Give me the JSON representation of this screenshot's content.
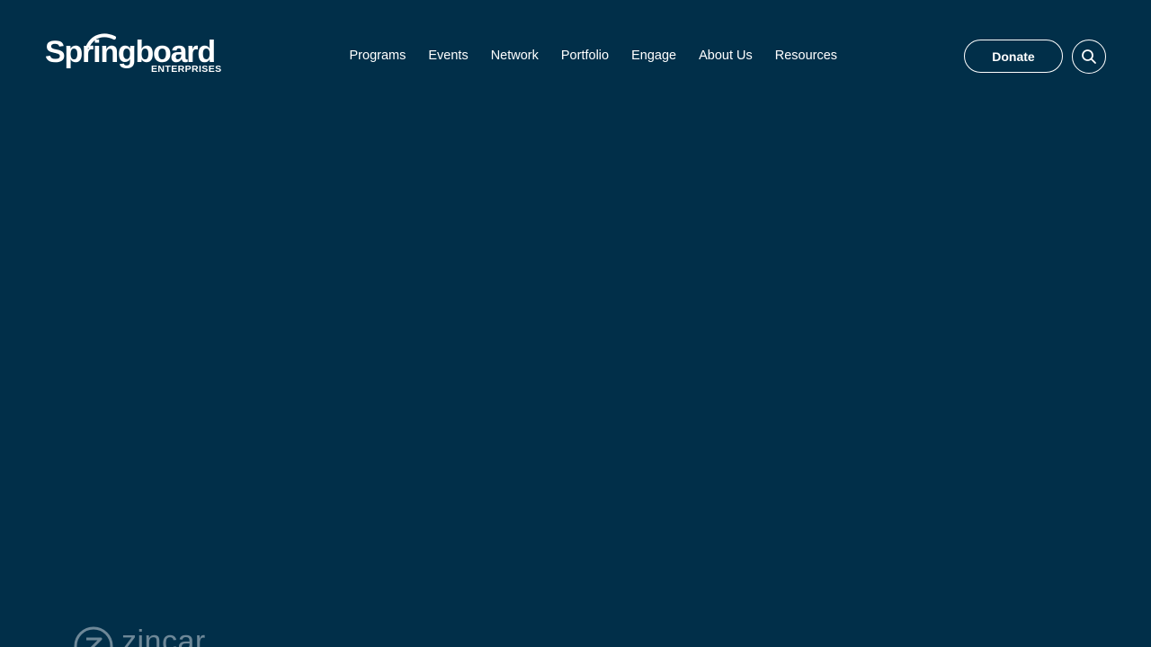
{
  "header": {
    "logo": {
      "main_text": "Springboard",
      "sub_text": "ENTERPRISES"
    },
    "nav": [
      {
        "label": "Programs"
      },
      {
        "label": "Events"
      },
      {
        "label": "Network"
      },
      {
        "label": "Portfolio"
      },
      {
        "label": "Engage"
      },
      {
        "label": "About Us"
      },
      {
        "label": "Resources"
      }
    ],
    "donate_label": "Donate",
    "search_icon": "search-icon"
  },
  "partner_logo": {
    "name": "zincar",
    "icon": "zincar-logo-icon"
  },
  "colors": {
    "background": "#012f49",
    "foreground": "#ffffff"
  }
}
